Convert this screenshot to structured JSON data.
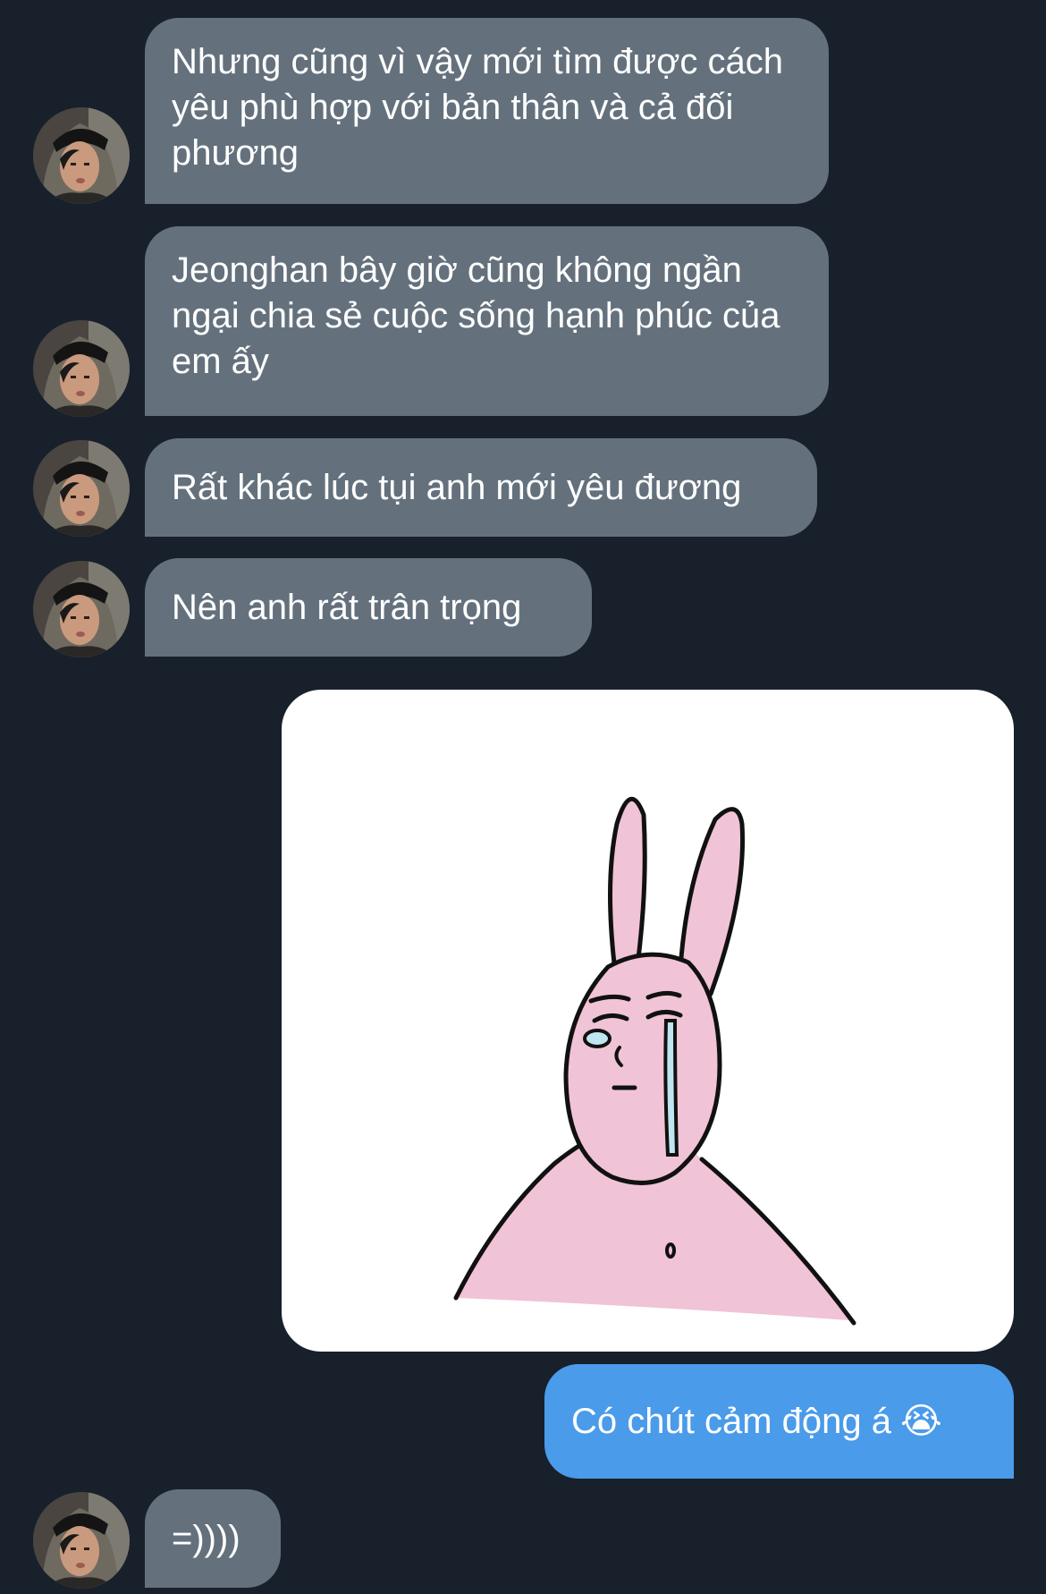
{
  "messages": [
    {
      "from": "other",
      "text": "Nhưng cũng vì vậy mới tìm được cách yêu phù hợp với bản thân và cả đối phương"
    },
    {
      "from": "other",
      "text": "Jeonghan bây giờ cũng không ngần ngại chia sẻ cuộc sống hạnh phúc của em ấy"
    },
    {
      "from": "other",
      "text": "Rất khác lúc tụi anh mới yêu đương"
    },
    {
      "from": "other",
      "text": "Nên anh rất trân trọng"
    },
    {
      "from": "me",
      "type": "sticker",
      "sticker": "crying-pink-rabbit"
    },
    {
      "from": "me",
      "text": "Có chút cảm động á",
      "emoji": "😭"
    },
    {
      "from": "other",
      "text": "=))))"
    }
  ],
  "colors": {
    "background": "#18202b",
    "incoming_bubble": "#64717d",
    "outgoing_bubble": "#4a9be9",
    "text": "#ffffff"
  }
}
